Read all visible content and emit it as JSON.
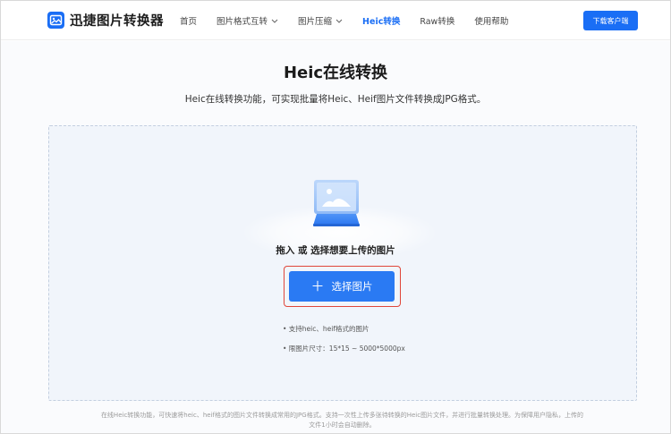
{
  "header": {
    "logo_text": "迅捷图片转换器",
    "nav": [
      {
        "label": "首页",
        "has_dropdown": false,
        "active": false
      },
      {
        "label": "图片格式互转",
        "has_dropdown": true,
        "active": false
      },
      {
        "label": "图片压缩",
        "has_dropdown": true,
        "active": false
      },
      {
        "label": "Heic转换",
        "has_dropdown": false,
        "active": true
      },
      {
        "label": "Raw转换",
        "has_dropdown": false,
        "active": false
      },
      {
        "label": "使用帮助",
        "has_dropdown": false,
        "active": false
      }
    ],
    "download_label": "下载客户端"
  },
  "main": {
    "title": "Heic在线转换",
    "subtitle": "Heic在线转换功能，可实现批量将Heic、Heif图片文件转换成JPG格式。",
    "drop_text": "拖入 或 选择想要上传的图片",
    "select_button": "选择图片",
    "tips": [
      "• 支持heic、heif格式的图片",
      "• 限图片尺寸：15*15 ~ 5000*5000px"
    ],
    "footer_line1": "在线Heic转换功能，可快速将heic、heif格式的图片文件转换成常用的JPG格式。支持一次性上传多张待转换的Heic图片文件，并进行批量转换处理。为保障用户隐私，上传的",
    "footer_line2": "文件1小时会自动删除。"
  },
  "colors": {
    "accent": "#1a6ef5",
    "button": "#2a7af3",
    "highlight_border": "#e0463a",
    "dropzone_bg": "#f1f5fb"
  },
  "icons": [
    "logo-image-icon",
    "chevron-down-icon",
    "upload-image-illustration",
    "plus-icon"
  ]
}
